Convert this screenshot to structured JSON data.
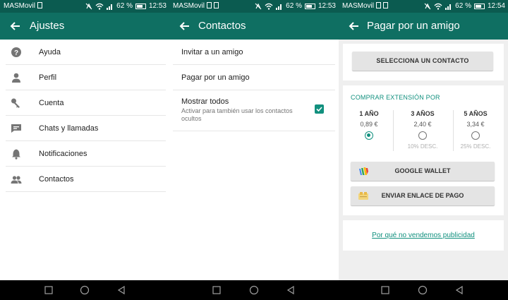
{
  "colors": {
    "status_bar": "#0b5b50",
    "toolbar": "#0f6f62",
    "accent": "#11907e",
    "nav_bar": "#000000"
  },
  "status_bar": {
    "screen1": {
      "carrier": "MASMovil",
      "battery": "62 %",
      "time": "12:53"
    },
    "screen2": {
      "carrier": "MASMovil",
      "battery": "62 %",
      "time": "12:53"
    },
    "screen3": {
      "carrier": "MASMovil",
      "battery": "62 %",
      "time": "12:54"
    },
    "icons": [
      "sim-icon",
      "gallery-icon",
      "mute-icon",
      "wifi-icon",
      "signal-icon",
      "battery-icon"
    ]
  },
  "settings": {
    "title": "Ajustes",
    "items": [
      {
        "label": "Ayuda",
        "icon": "help-icon"
      },
      {
        "label": "Perfil",
        "icon": "person-icon"
      },
      {
        "label": "Cuenta",
        "icon": "key-icon"
      },
      {
        "label": "Chats y llamadas",
        "icon": "chat-icon"
      },
      {
        "label": "Notificaciones",
        "icon": "bell-icon"
      },
      {
        "label": "Contactos",
        "icon": "contacts-icon"
      }
    ]
  },
  "contacts": {
    "title": "Contactos",
    "invite": "Invitar a un amigo",
    "pay_for_friend": "Pagar por un amigo",
    "show_all": {
      "label": "Mostrar todos",
      "description": "Activar para también usar los contactos ocultos",
      "checked": true
    }
  },
  "pay": {
    "title": "Pagar por un amigo",
    "select_contact": "SELECCIONA UN CONTACTO",
    "section_title": "COMPRAR EXTENSIÓN POR",
    "options": [
      {
        "years": "1 AÑO",
        "price": "0,89 €",
        "discount": "",
        "selected": true
      },
      {
        "years": "3 AÑOS",
        "price": "2,40 €",
        "discount": "10% DESC.",
        "selected": false
      },
      {
        "years": "5 AÑOS",
        "price": "3,34 €",
        "discount": "25% DESC.",
        "selected": false
      }
    ],
    "google_wallet": "GOOGLE WALLET",
    "send_link": "ENVIAR ENLACE DE PAGO",
    "no_ads_link": "Por qué no vendemos publicidad"
  },
  "navigation": [
    "back-nav-icon",
    "home-nav-icon",
    "recents-nav-icon"
  ]
}
